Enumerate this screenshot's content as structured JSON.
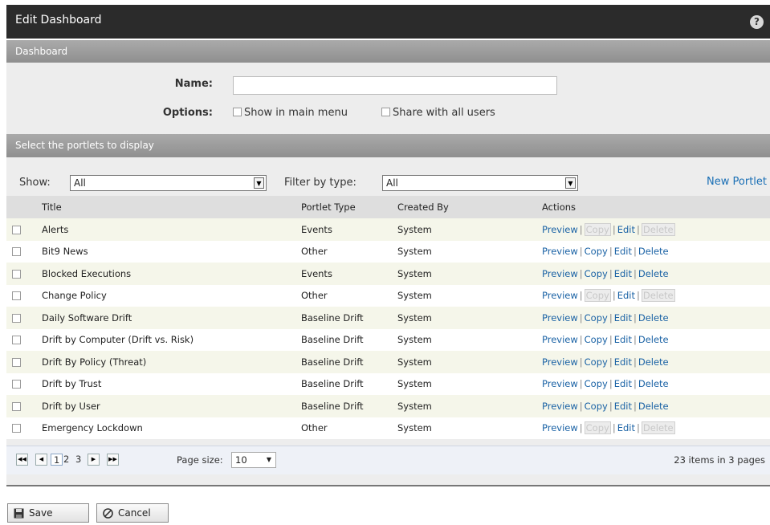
{
  "window": {
    "title": "Edit Dashboard"
  },
  "sections": {
    "dashboard": "Dashboard",
    "portlets": "Select the portlets to display"
  },
  "form": {
    "name_label": "Name:",
    "name_value": "",
    "options_label": "Options:",
    "show_in_main_menu": "Show in main menu",
    "share_with_all_users": "Share with all users"
  },
  "filters": {
    "show_label": "Show:",
    "show_value": "All",
    "filter_label": "Filter by type:",
    "filter_value": "All",
    "new_portlet": "New Portlet"
  },
  "grid": {
    "headers": {
      "title": "Title",
      "type": "Portlet Type",
      "created_by": "Created By",
      "actions": "Actions"
    },
    "action_labels": {
      "preview": "Preview",
      "copy": "Copy",
      "edit": "Edit",
      "delete": "Delete"
    },
    "rows": [
      {
        "title": "Alerts",
        "type": "Events",
        "created_by": "System",
        "copy_disabled": true,
        "delete_disabled": true
      },
      {
        "title": "Bit9 News",
        "type": "Other",
        "created_by": "System",
        "copy_disabled": false,
        "delete_disabled": false
      },
      {
        "title": "Blocked Executions",
        "type": "Events",
        "created_by": "System",
        "copy_disabled": false,
        "delete_disabled": false
      },
      {
        "title": "Change Policy",
        "type": "Other",
        "created_by": "System",
        "copy_disabled": true,
        "delete_disabled": true
      },
      {
        "title": "Daily Software Drift",
        "type": "Baseline Drift",
        "created_by": "System",
        "copy_disabled": false,
        "delete_disabled": false
      },
      {
        "title": "Drift by Computer (Drift vs. Risk)",
        "type": "Baseline Drift",
        "created_by": "System",
        "copy_disabled": false,
        "delete_disabled": false
      },
      {
        "title": "Drift By Policy (Threat)",
        "type": "Baseline Drift",
        "created_by": "System",
        "copy_disabled": false,
        "delete_disabled": false
      },
      {
        "title": "Drift by Trust",
        "type": "Baseline Drift",
        "created_by": "System",
        "copy_disabled": false,
        "delete_disabled": false
      },
      {
        "title": "Drift by User",
        "type": "Baseline Drift",
        "created_by": "System",
        "copy_disabled": false,
        "delete_disabled": false
      },
      {
        "title": "Emergency Lockdown",
        "type": "Other",
        "created_by": "System",
        "copy_disabled": true,
        "delete_disabled": true
      }
    ]
  },
  "pager": {
    "pages": [
      "1",
      "2",
      "3"
    ],
    "current_page": "1",
    "page_size_label": "Page size:",
    "page_size": "10",
    "info": "23 items in 3 pages"
  },
  "buttons": {
    "save": "Save",
    "cancel": "Cancel"
  }
}
